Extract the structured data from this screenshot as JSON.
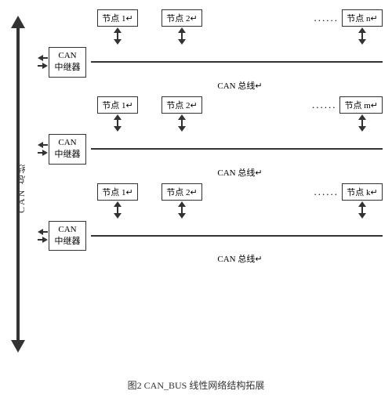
{
  "title": "图2 CAN_BUS 线性网络结构拓展",
  "left_label": "CAN 总线",
  "segments": [
    {
      "id": "top",
      "nodes": [
        "节点 1",
        "节点 2",
        "节点 n"
      ],
      "repeater_line1": "CAN",
      "repeater_line2": "中继器",
      "bus_label": "CAN 总线"
    },
    {
      "id": "mid",
      "nodes": [
        "节点 1",
        "节点 2",
        "节点 m"
      ],
      "repeater_line1": "CAN",
      "repeater_line2": "中继器",
      "bus_label": "CAN 总线"
    },
    {
      "id": "bot",
      "nodes": [
        "节点 1",
        "节点 2",
        "节点 k"
      ],
      "repeater_line1": "CAN",
      "repeater_line2": "中继器",
      "bus_label": "CAN 总线"
    }
  ],
  "caption": "图2 CAN_BUS 线性网络结构拓展"
}
